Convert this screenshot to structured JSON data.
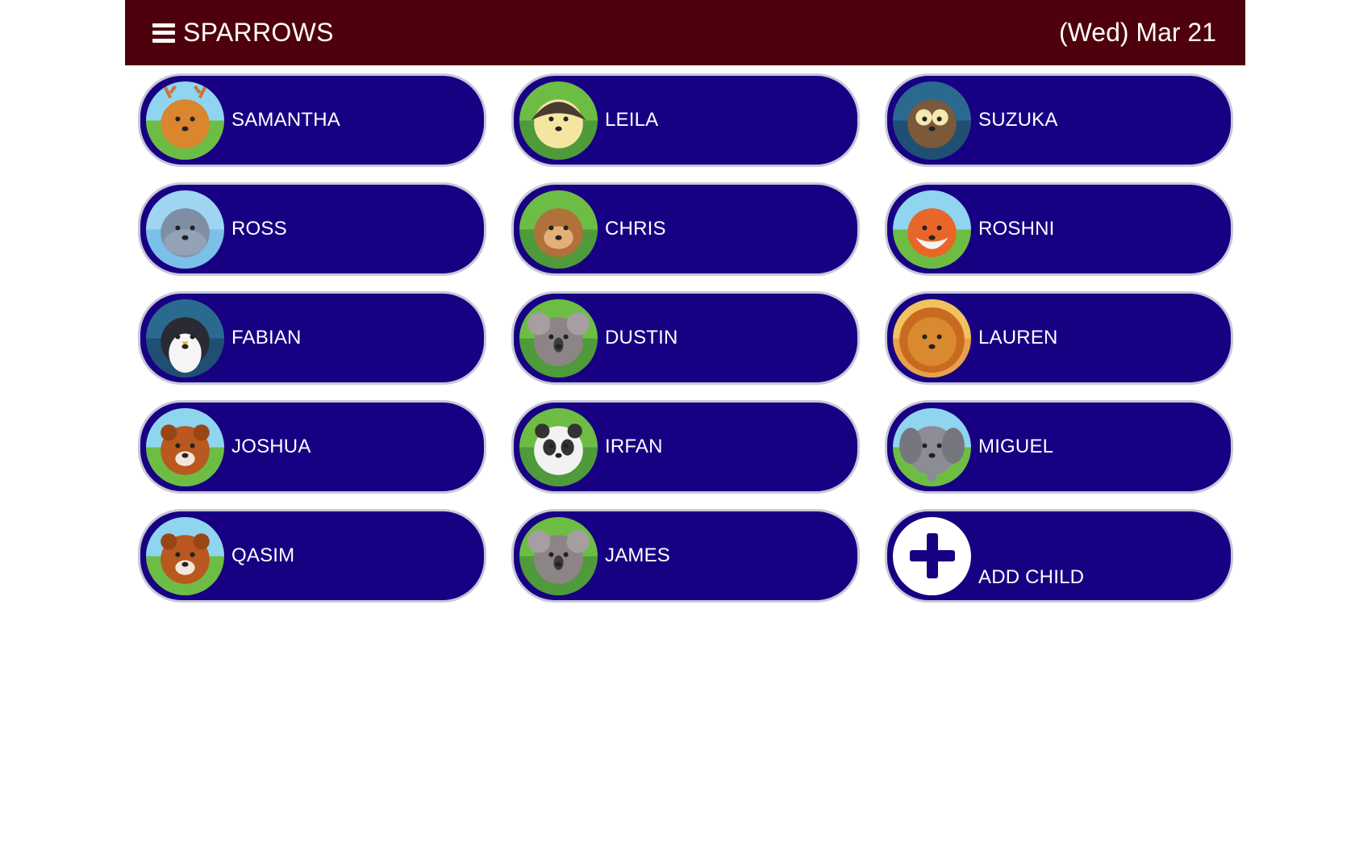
{
  "header": {
    "menu_icon": "hamburger-menu-icon",
    "class_name": "SPARROWS",
    "date": "(Wed) Mar 21"
  },
  "colors": {
    "header_bg": "#4e000c",
    "card_bg": "#180083",
    "card_border": "#c8c8d8"
  },
  "children": [
    {
      "name": "SAMANTHA",
      "avatar": "deer",
      "icon": "deer-avatar-icon"
    },
    {
      "name": "LEILA",
      "avatar": "hedgehog",
      "icon": "hedgehog-avatar-icon"
    },
    {
      "name": "SUZUKA",
      "avatar": "owl",
      "icon": "owl-avatar-icon"
    },
    {
      "name": "ROSS",
      "avatar": "hippo",
      "icon": "hippo-avatar-icon"
    },
    {
      "name": "CHRIS",
      "avatar": "monkey",
      "icon": "monkey-avatar-icon"
    },
    {
      "name": "ROSHNI",
      "avatar": "fox",
      "icon": "fox-avatar-icon"
    },
    {
      "name": "FABIAN",
      "avatar": "penguin",
      "icon": "penguin-avatar-icon"
    },
    {
      "name": "DUSTIN",
      "avatar": "koala",
      "icon": "koala-avatar-icon"
    },
    {
      "name": "LAUREN",
      "avatar": "lion",
      "icon": "lion-avatar-icon"
    },
    {
      "name": "JOSHUA",
      "avatar": "bear",
      "icon": "bear-avatar-icon"
    },
    {
      "name": "IRFAN",
      "avatar": "panda",
      "icon": "panda-avatar-icon"
    },
    {
      "name": "MIGUEL",
      "avatar": "elephant",
      "icon": "elephant-avatar-icon"
    },
    {
      "name": "QASIM",
      "avatar": "bear",
      "icon": "bear-avatar-icon"
    },
    {
      "name": "JAMES",
      "avatar": "koala",
      "icon": "koala-avatar-icon"
    }
  ],
  "add_child": {
    "label": "ADD CHILD",
    "icon": "plus-icon"
  }
}
